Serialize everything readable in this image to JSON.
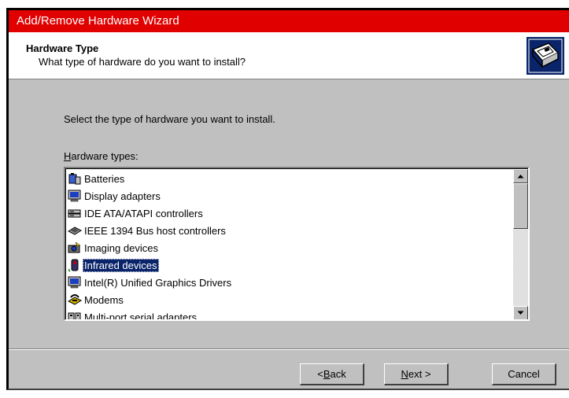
{
  "window": {
    "title": "Add/Remove Hardware Wizard"
  },
  "header": {
    "title": "Hardware Type",
    "subtitle": "What type of hardware do you want to install?",
    "icon": "hardware-wizard-icon"
  },
  "main": {
    "instruction": "Select the type of hardware you want to install.",
    "list_label_prefix": "H",
    "list_label_rest": "ardware types:",
    "list_items": [
      {
        "label": "Batteries",
        "icon": "battery-icon"
      },
      {
        "label": "Display adapters",
        "icon": "monitor-icon"
      },
      {
        "label": "IDE ATA/ATAPI controllers",
        "icon": "drive-icon"
      },
      {
        "label": "IEEE 1394 Bus host controllers",
        "icon": "bus-controller-icon"
      },
      {
        "label": "Imaging devices",
        "icon": "camera-icon"
      },
      {
        "label": "Infrared devices",
        "icon": "infrared-icon",
        "selected": true
      },
      {
        "label": "Intel(R) Unified Graphics Drivers",
        "icon": "monitor-icon"
      },
      {
        "label": "Modems",
        "icon": "modem-icon"
      },
      {
        "label": "Multi-port serial adapters",
        "icon": "serial-adapter-icon"
      }
    ]
  },
  "buttons": {
    "back_prefix": "< ",
    "back_u": "B",
    "back_rest": "ack",
    "next_u": "N",
    "next_rest": "ext >",
    "cancel": "Cancel"
  }
}
